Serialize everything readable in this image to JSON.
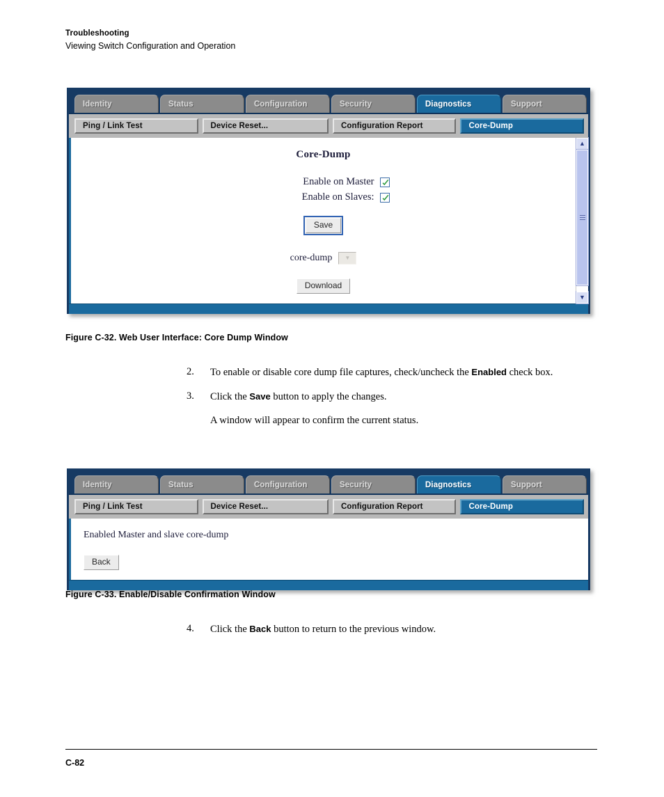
{
  "page": {
    "running_header_title": "Troubleshooting",
    "running_header_subtitle": "Viewing Switch Configuration and Operation",
    "page_number": "C-82"
  },
  "colors": {
    "window_frame": "#173a63",
    "tab_active": "#1a6a9e",
    "tab_inactive": "#8b8b8b",
    "subtab_bar": "#b8b8b8",
    "checkbox_check": "#2e9a3e",
    "scrollbar_thumb": "#b9c4ee"
  },
  "window1": {
    "tabs": [
      {
        "label": "Identity",
        "active": false
      },
      {
        "label": "Status",
        "active": false
      },
      {
        "label": "Configuration",
        "active": false
      },
      {
        "label": "Security",
        "active": false
      },
      {
        "label": "Diagnostics",
        "active": true
      },
      {
        "label": "Support",
        "active": false
      }
    ],
    "subtabs": [
      {
        "label": "Ping / Link Test",
        "active": false
      },
      {
        "label": "Device Reset...",
        "active": false
      },
      {
        "label": "Configuration Report",
        "active": false
      },
      {
        "label": "Core-Dump",
        "active": true
      }
    ],
    "form": {
      "title": "Core-Dump",
      "checkboxes": [
        {
          "label": "Enable on Master",
          "checked": true
        },
        {
          "label": "Enable on Slaves:",
          "checked": true
        }
      ],
      "save_label": "Save",
      "select_label": "core-dump",
      "select_value": "",
      "select_disabled": true,
      "download_label": "Download"
    },
    "scrollbar": {
      "up_arrow": "⌃",
      "down_arrow": "⌄"
    }
  },
  "window2": {
    "tabs": [
      {
        "label": "Identity",
        "active": false
      },
      {
        "label": "Status",
        "active": false
      },
      {
        "label": "Configuration",
        "active": false
      },
      {
        "label": "Security",
        "active": false
      },
      {
        "label": "Diagnostics",
        "active": true
      },
      {
        "label": "Support",
        "active": false
      }
    ],
    "subtabs": [
      {
        "label": "Ping / Link Test",
        "active": false
      },
      {
        "label": "Device Reset...",
        "active": false
      },
      {
        "label": "Configuration Report",
        "active": false
      },
      {
        "label": "Core-Dump",
        "active": true
      }
    ],
    "message": "Enabled Master and slave core-dump",
    "back_label": "Back"
  },
  "captions": {
    "figure_32": "Figure C-32. Web User Interface: Core Dump Window",
    "figure_33": "Figure C-33. Enable/Disable Confirmation Window"
  },
  "steps": [
    {
      "number": "2.",
      "text_before": "To enable or disable core dump file captures, check/uncheck the ",
      "emphasis": "Enabled",
      "text_after": " check box."
    },
    {
      "number": "3.",
      "text_before": "Click the ",
      "emphasis": "Save",
      "text_after": " button to apply the changes."
    },
    {
      "number": "4.",
      "text_before": "Click the ",
      "emphasis": "Back",
      "text_after": " button to return to the previous window."
    }
  ],
  "step_note": "A window will appear to confirm the current status."
}
